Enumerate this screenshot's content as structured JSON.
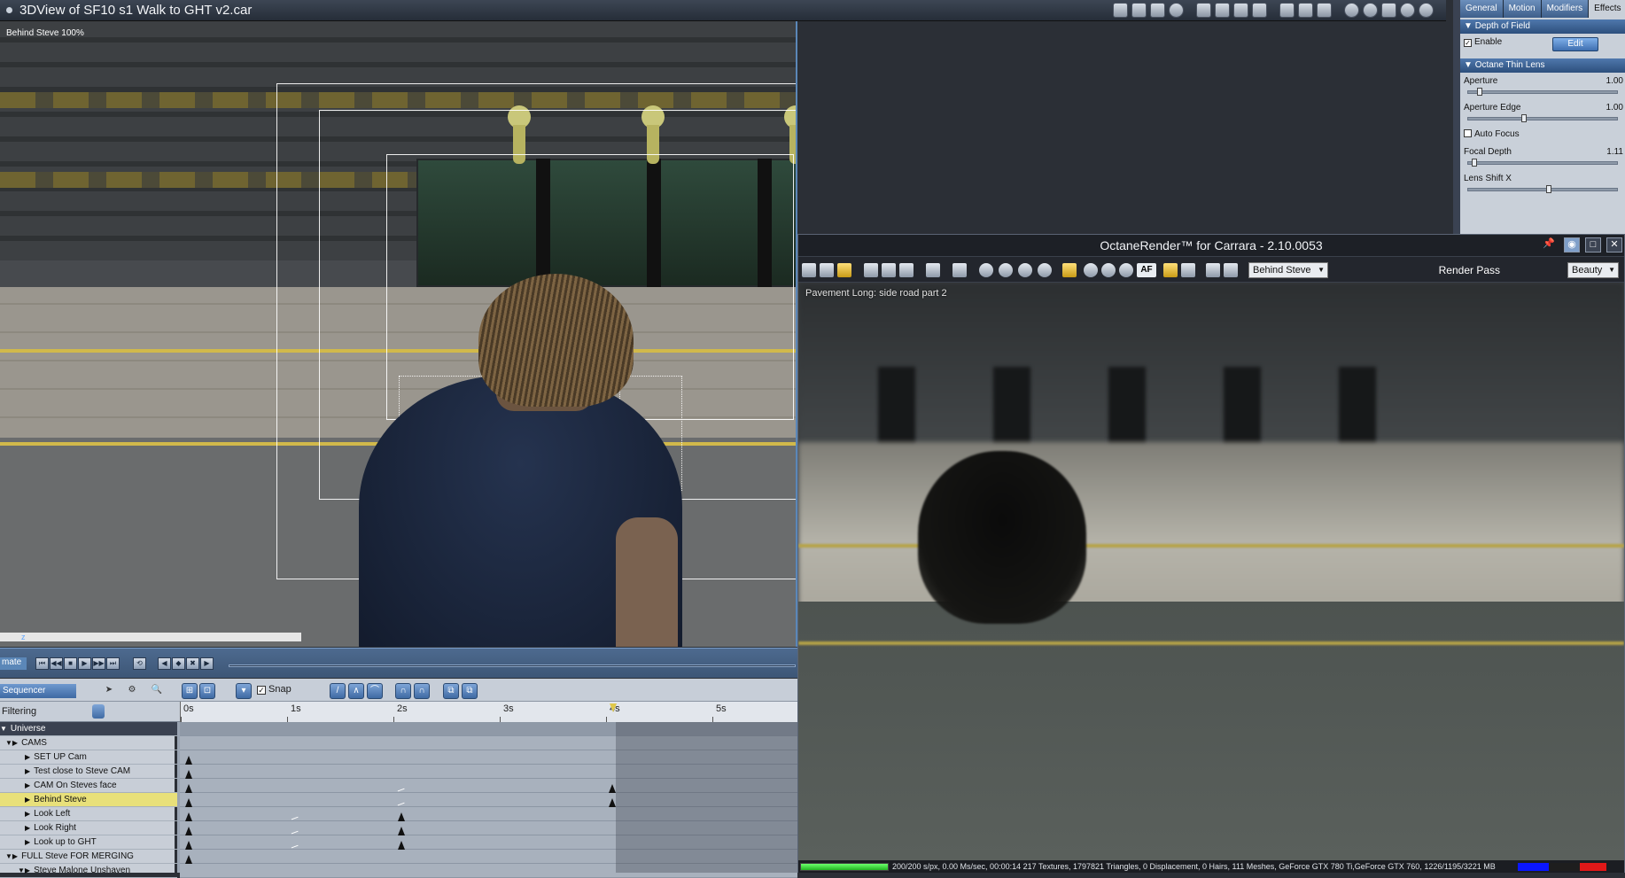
{
  "window": {
    "title": "3DView of SF10 s1 Walk to GHT v2.car"
  },
  "viewport": {
    "camera_label": "Behind Steve 100%",
    "axis_label": "z"
  },
  "transport": {
    "tab_label": "mate"
  },
  "sequencer": {
    "mode_label": "Sequencer",
    "snap_label": "Snap",
    "snap_checked": "✓",
    "filtering_label": "Filtering",
    "ruler": [
      "0s",
      "1s",
      "2s",
      "3s",
      "4s",
      "5s"
    ]
  },
  "tracks": [
    {
      "label": "Universe",
      "type": "head"
    },
    {
      "label": "CAMS",
      "type": "group"
    },
    {
      "label": "SET UP Cam",
      "type": "item"
    },
    {
      "label": "Test close to Steve CAM",
      "type": "item"
    },
    {
      "label": "CAM On Steves face",
      "type": "item"
    },
    {
      "label": "Behind Steve",
      "type": "selected"
    },
    {
      "label": "Look Left",
      "type": "item"
    },
    {
      "label": "Look Right",
      "type": "item"
    },
    {
      "label": "Look up to GHT",
      "type": "item"
    },
    {
      "label": "FULL Steve FOR MERGING",
      "type": "group"
    },
    {
      "label": "Steve Malone Unshaven",
      "type": "item"
    }
  ],
  "panel": {
    "tabs": [
      "General",
      "Motion",
      "Modifiers",
      "Effects"
    ],
    "active_tab": "Effects",
    "depth_of_field_header": "Depth of Field",
    "enable_label": "Enable",
    "enable_checked": "✓",
    "edit_label": "Edit",
    "thin_lens_header": "Octane Thin Lens",
    "aperture_label": "Aperture",
    "aperture_value": "1.00",
    "aperture_edge_label": "Aperture Edge",
    "aperture_edge_value": "1.00",
    "auto_focus_label": "Auto Focus",
    "focal_depth_label": "Focal Depth",
    "focal_depth_value": "1.11",
    "lens_shift_x_label": "Lens Shift X"
  },
  "octane": {
    "title": "OctaneRender™ for Carrara - 2.10.0053",
    "camera_select": "Behind Steve",
    "af_label": "AF",
    "render_pass_label": "Render Pass",
    "render_pass_value": "Beauty",
    "overlay_label": "Pavement Long: side road part 2",
    "progress": 1.0,
    "status": "200/200 s/px, 0.00 Ms/sec, 00:00:14   217 Textures, 1797821 Triangles, 0 Displacement, 0 Hairs, 111 Meshes, GeForce GTX 780 Ti,GeForce GTX 760,  1226/1195/3221 MB",
    "vram_colors": [
      "#0a16ff",
      "#1e1e1e",
      "#e01818"
    ]
  }
}
